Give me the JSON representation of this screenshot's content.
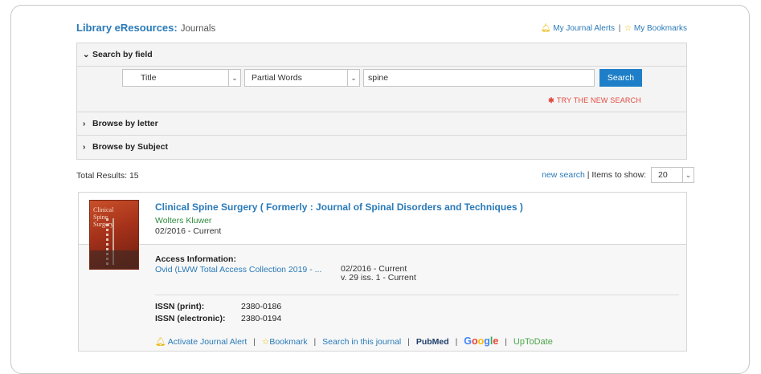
{
  "header": {
    "brand": "Library eResources:",
    "subtitle": "Journals",
    "alerts_link": "My Journal Alerts",
    "separator": "|",
    "bookmarks_link": "My Bookmarks"
  },
  "search_panel": {
    "search_by_field": {
      "label": "Search by field",
      "chevron": "⌄"
    },
    "field_select": {
      "value": "Title"
    },
    "match_select": {
      "value": "Partial Words"
    },
    "query_input": {
      "value": "spine"
    },
    "search_button": "Search",
    "try_new_search": "TRY THE NEW SEARCH",
    "browse_by_letter": {
      "label": "Browse by letter",
      "chevron": "›"
    },
    "browse_by_subject": {
      "label": "Browse by Subject",
      "chevron": "›"
    }
  },
  "results_bar": {
    "total": "Total Results: 15",
    "new_search": "new search",
    "items_label": "| Items to show:",
    "items_value": "20"
  },
  "result": {
    "cover_text": [
      "Clinical",
      "Spine",
      "Surgery"
    ],
    "title": "Clinical Spine Surgery ( Formerly : Journal of Spinal Disorders and Techniques )",
    "publisher": "Wolters Kluwer",
    "dates": "02/2016 - Current",
    "access_heading": "Access Information:",
    "access_link": "Ovid (LWW Total Access Collection 2019 - ...",
    "access_dates": "02/2016 - Current",
    "access_volume": "v. 29 iss. 1 - Current",
    "issn_print_label": "ISSN (print):",
    "issn_print": "2380-0186",
    "issn_electronic_label": "ISSN (electronic):",
    "issn_electronic": "2380-0194",
    "actions": {
      "alert": "Activate Journal Alert",
      "bookmark": "Bookmark",
      "search_journal": "Search in this journal",
      "pubmed": "PubMed",
      "google": [
        "G",
        "o",
        "o",
        "g",
        "l",
        "e"
      ],
      "uptodate": "UpToDate"
    }
  },
  "colors": {
    "link_blue": "#2a7ab8",
    "button_blue": "#1e7fc8",
    "publisher_green": "#2e8b3e",
    "alert_red": "#e34a3f"
  },
  "icons": [
    "bell-icon",
    "star-icon",
    "chevron-down-icon",
    "chevron-right-icon",
    "asterisk-icon"
  ]
}
